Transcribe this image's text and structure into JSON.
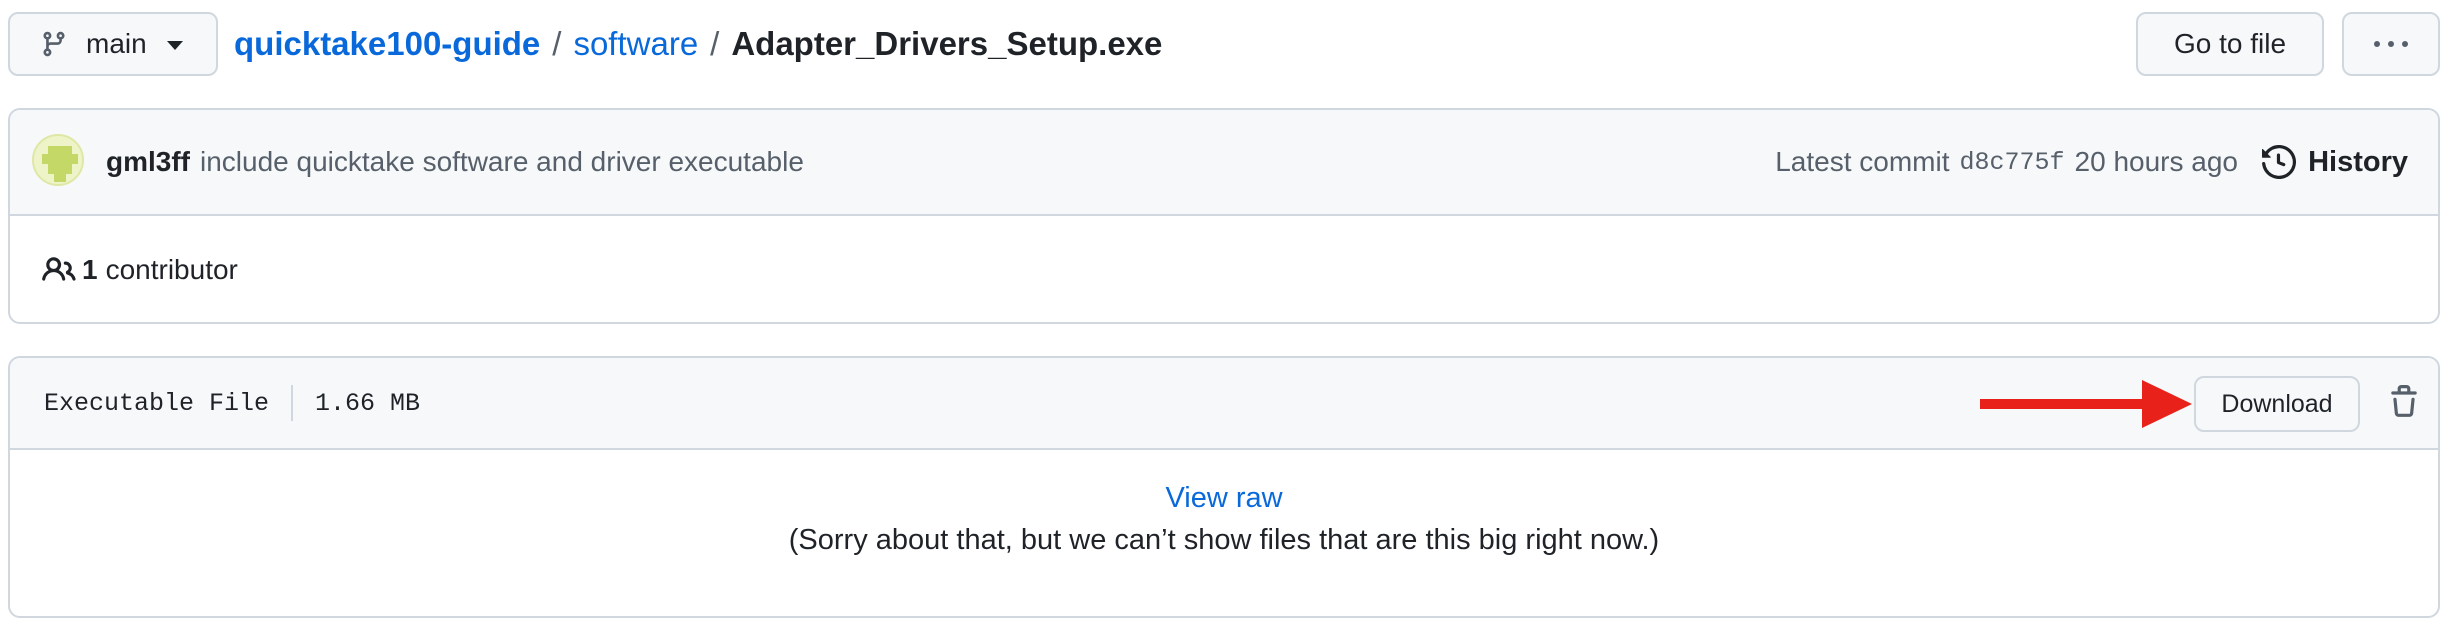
{
  "branch": {
    "label": "main",
    "icon": "git-branch-icon"
  },
  "breadcrumb": {
    "repo": "quicktake100-guide",
    "separator": "/",
    "directory": "software",
    "file": "Adapter_Drivers_Setup.exe"
  },
  "toolbar": {
    "go_to_file_label": "Go to file",
    "more_icon": "kebab-horizontal-icon"
  },
  "commit": {
    "author": "gml3ff",
    "message": "include quicktake software and driver executable",
    "latest_label": "Latest commit",
    "sha": "d8c775f",
    "time": "20 hours ago",
    "history_label": "History"
  },
  "contributors": {
    "count": "1",
    "label": "contributor"
  },
  "file": {
    "type": "Executable File",
    "size": "1.66 MB",
    "download_label": "Download",
    "view_raw_label": "View raw",
    "too_big_message": "(Sorry about that, but we can’t show files that are this big right now.)"
  },
  "colors": {
    "link": "#0969da",
    "border": "#d0d7de",
    "header_bg": "#f6f8fa",
    "annotation_arrow": "#e8221b"
  }
}
